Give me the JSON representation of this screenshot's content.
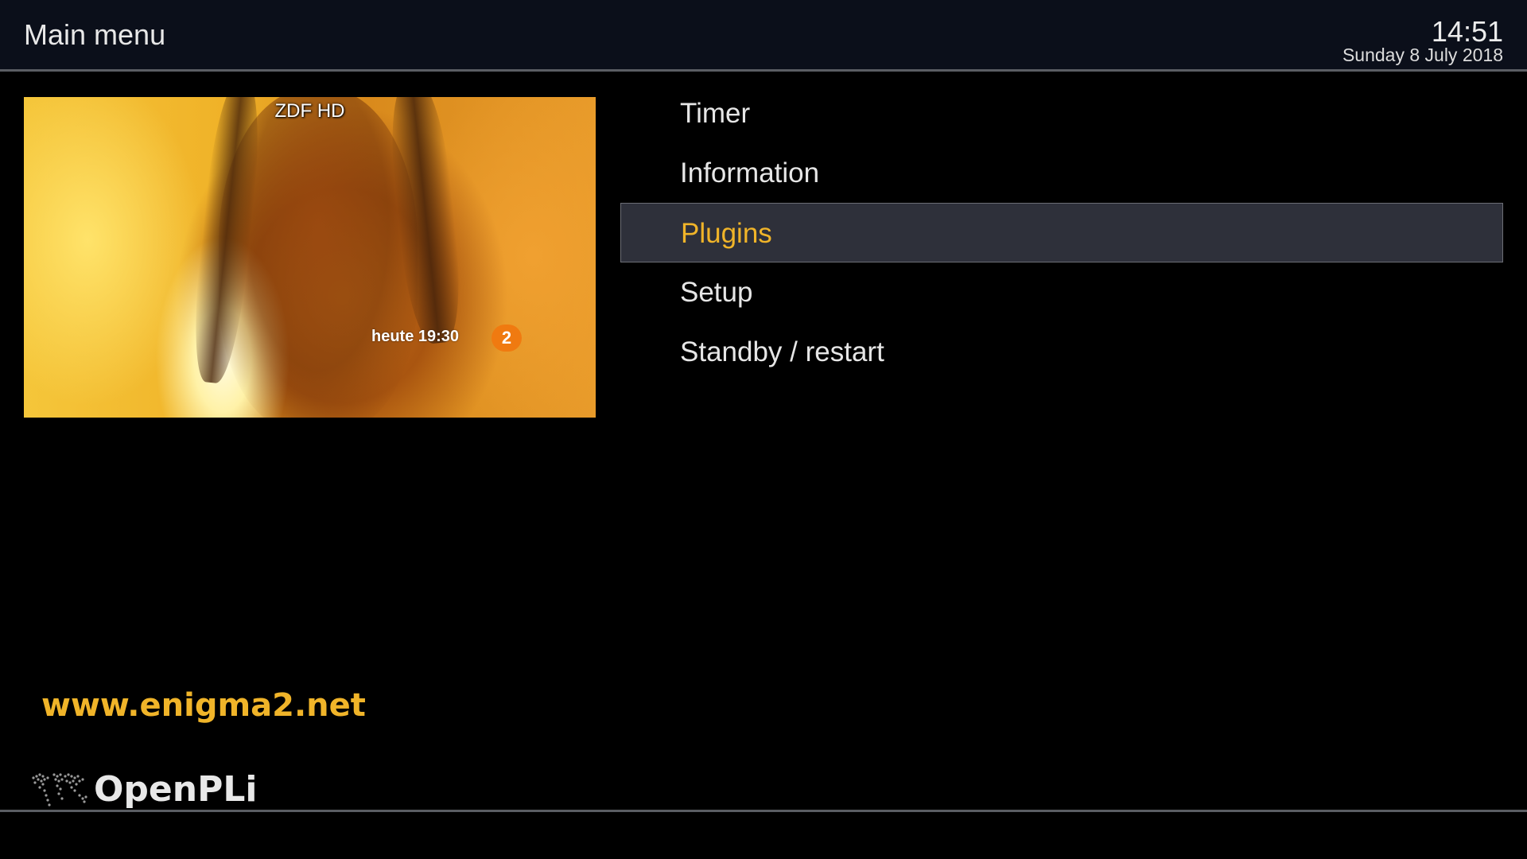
{
  "header": {
    "title": "Main menu",
    "time": "14:51",
    "date": "Sunday  8 July 2018"
  },
  "preview": {
    "channel": "ZDF HD",
    "osd_text": "heute 19:30",
    "osd_logo": "2"
  },
  "menu": {
    "items": [
      {
        "label": "Timer",
        "selected": false
      },
      {
        "label": "Information",
        "selected": false
      },
      {
        "label": "Plugins",
        "selected": true
      },
      {
        "label": "Setup",
        "selected": false
      },
      {
        "label": "Standby / restart",
        "selected": false
      }
    ]
  },
  "footer": {
    "website": "www.enigma2.net",
    "brand": "OpenPLi",
    "brand_icon": "world-map-icon"
  },
  "colors": {
    "header_bg": "#0b0f1a",
    "accent": "#f0b429",
    "selection_bg": "#2e303a",
    "text": "#e6e6e6"
  }
}
